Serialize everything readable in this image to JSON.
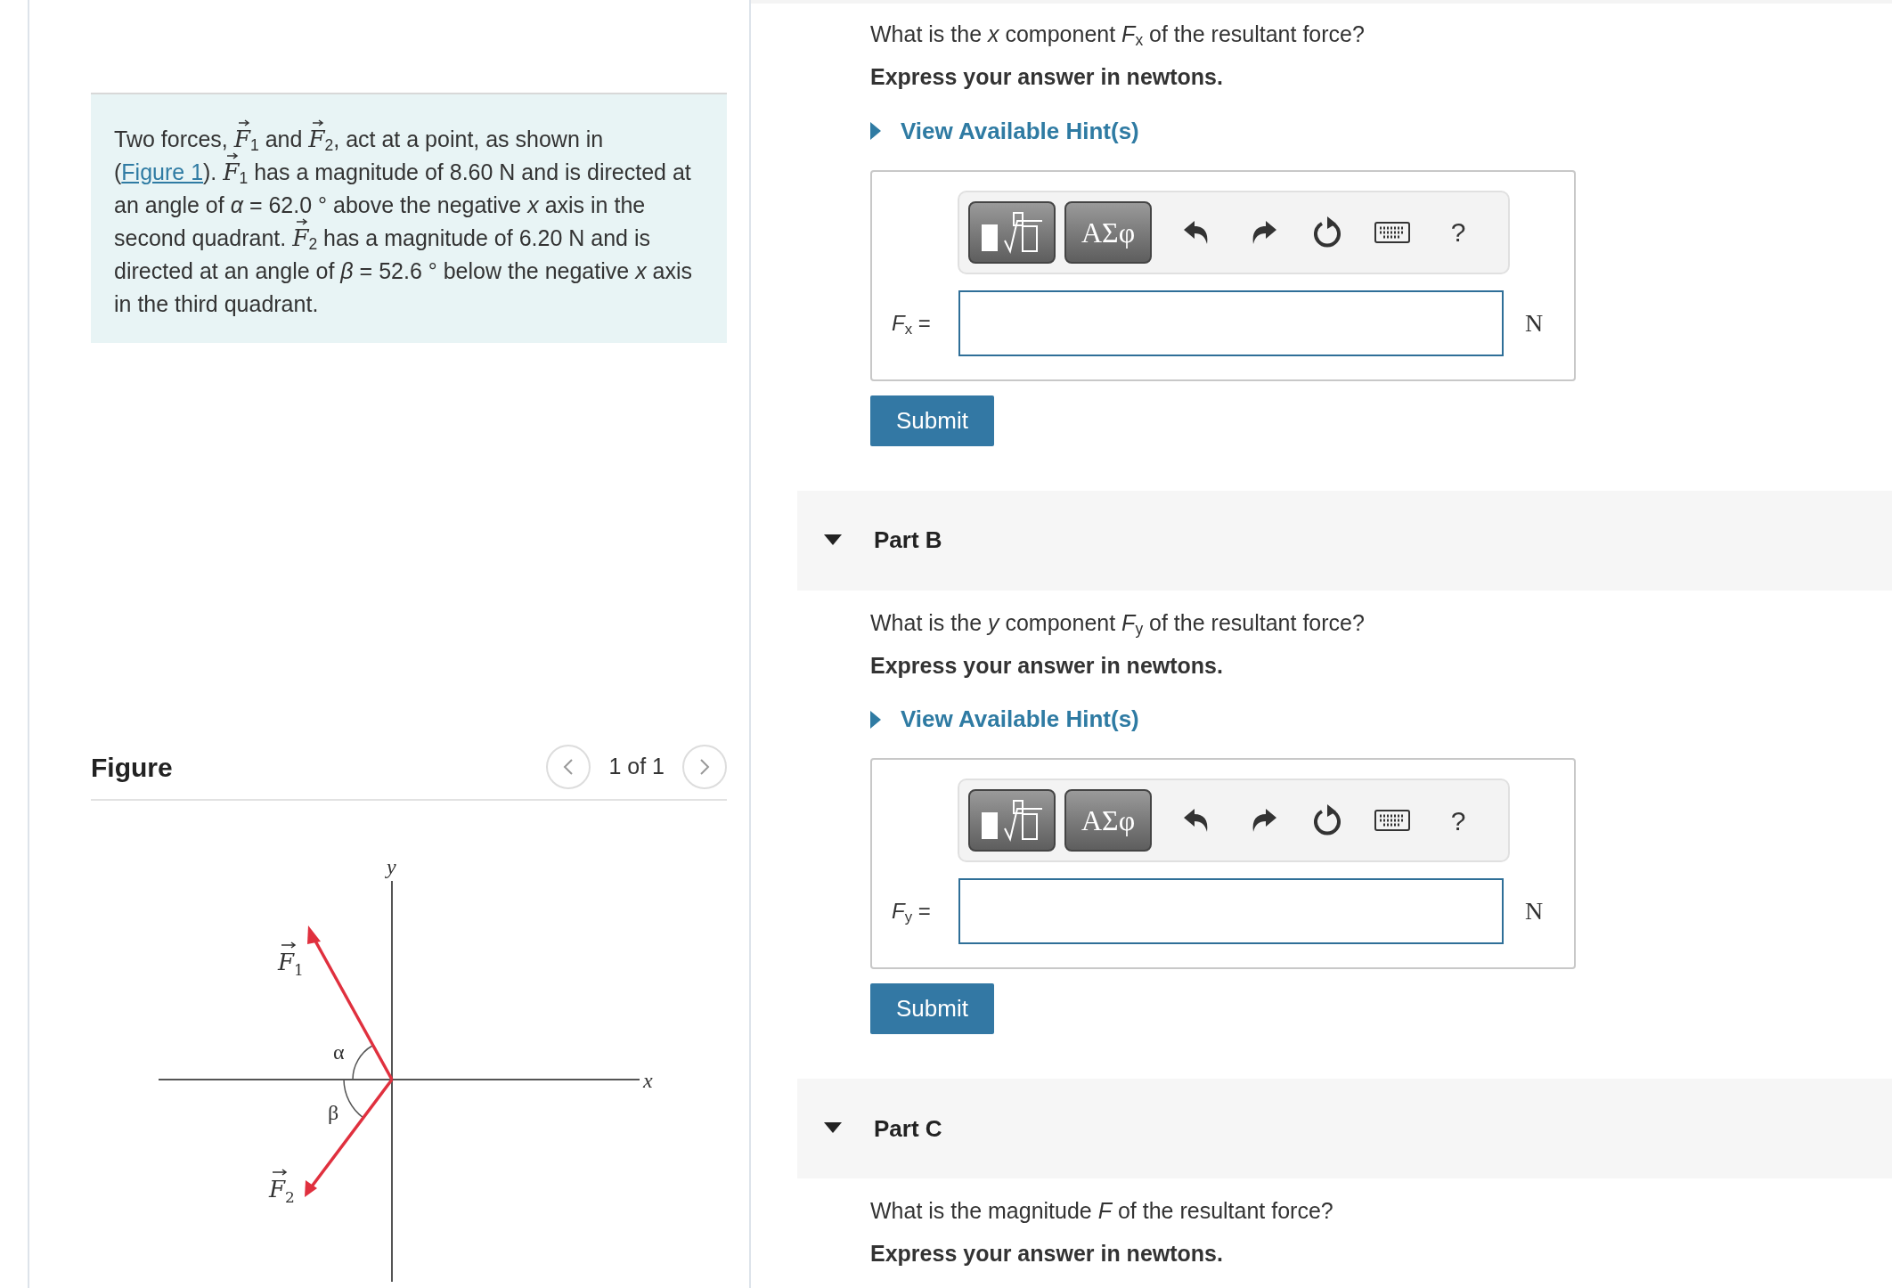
{
  "problem": {
    "segments": [
      {
        "kind": "text",
        "text": "Two forces, "
      },
      {
        "kind": "vector",
        "symbol": "F",
        "subscript": "1"
      },
      {
        "kind": "text",
        "text": " and "
      },
      {
        "kind": "vector",
        "symbol": "F",
        "subscript": "2"
      },
      {
        "kind": "text",
        "text": ", act at a point, as shown in ("
      },
      {
        "kind": "link",
        "text": "Figure 1"
      },
      {
        "kind": "text",
        "text": "). "
      },
      {
        "kind": "vector",
        "symbol": "F",
        "subscript": "1"
      },
      {
        "kind": "text",
        "text": " has a magnitude of 8.60 N and is directed at an angle of *α* = 62.0 ° above the negative *x* axis in the second quadrant. "
      },
      {
        "kind": "vector",
        "symbol": "F",
        "subscript": "2"
      },
      {
        "kind": "text",
        "text": " has a magnitude of 6.20 N and is directed at an angle of *β* = 52.6 ° below the negative *x* axis in the third quadrant."
      }
    ]
  },
  "figure": {
    "title": "Figure",
    "pager": "1 of 1",
    "axis_x": "x",
    "axis_y": "y",
    "vectors": [
      {
        "symbol": "F",
        "subscript": "1",
        "angle": "α"
      },
      {
        "symbol": "F",
        "subscript": "2",
        "angle": "β"
      }
    ]
  },
  "parts": [
    {
      "question": "What is the *x* component *F*$_{x}$ of the resultant force?",
      "instruction": "Express your answer in newtons.",
      "hint": "View Available Hint(s)",
      "toolbar": {
        "greek": "ΑΣφ",
        "help": "?"
      },
      "label": "*F*$_{x}$ =",
      "unit": "N",
      "submit": "Submit"
    },
    {
      "title": "Part B",
      "expanded": true,
      "question": "What is the *y* component *F*$_{y}$ of the resultant force?",
      "instruction": "Express your answer in newtons.",
      "hint": "View Available Hint(s)",
      "toolbar": {
        "greek": "ΑΣφ",
        "help": "?"
      },
      "label": "*F*$_{y}$ =",
      "unit": "N",
      "submit": "Submit"
    },
    {
      "title": "Part C",
      "expanded": true,
      "question": "What is the magnitude *F* of the resultant force?",
      "instruction": "Express your answer in newtons."
    }
  ]
}
